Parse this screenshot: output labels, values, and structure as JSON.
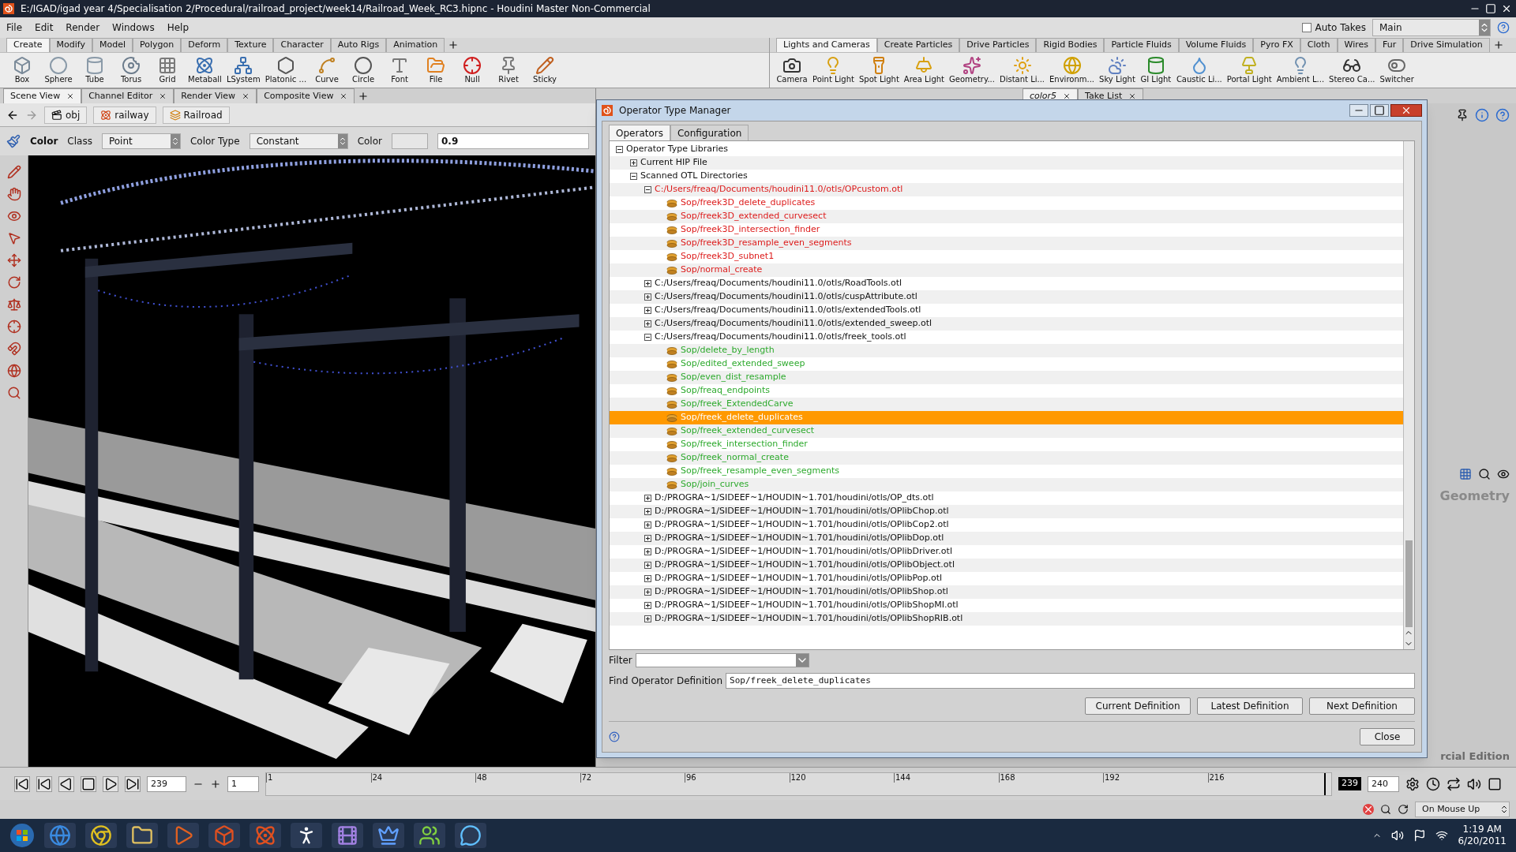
{
  "window": {
    "title": "E:/IGAD/igad year 4/Specialisation 2/Procedural/railroad_project/week14/Railroad_Week_RC3.hipnc - Houdini Master Non-Commercial"
  },
  "menu": [
    "File",
    "Edit",
    "Render",
    "Windows",
    "Help"
  ],
  "takes": {
    "auto_takes": {
      "label": "Auto Takes",
      "checked": false
    },
    "desktop": "Main"
  },
  "shelf_left": {
    "tabs": [
      {
        "label": "Create",
        "selected": true
      },
      {
        "label": "Modify",
        "selected": false
      },
      {
        "label": "Model",
        "selected": false
      },
      {
        "label": "Polygon",
        "selected": false
      },
      {
        "label": "Deform",
        "selected": false
      },
      {
        "label": "Texture",
        "selected": false
      },
      {
        "label": "Character",
        "selected": false
      },
      {
        "label": "Auto Rigs",
        "selected": false
      },
      {
        "label": "Animation",
        "selected": false
      }
    ],
    "tools": [
      "Box",
      "Sphere",
      "Tube",
      "Torus",
      "Grid",
      "Metaball",
      "LSystem",
      "Platonic ...",
      "Curve",
      "Circle",
      "Font",
      "File",
      "Null",
      "Rivet",
      "Sticky"
    ]
  },
  "shelf_right": {
    "tabs": [
      {
        "label": "Lights and Cameras",
        "selected": true
      },
      {
        "label": "Create Particles",
        "selected": false
      },
      {
        "label": "Drive Particles",
        "selected": false
      },
      {
        "label": "Rigid Bodies",
        "selected": false
      },
      {
        "label": "Particle Fluids",
        "selected": false
      },
      {
        "label": "Volume Fluids",
        "selected": false
      },
      {
        "label": "Pyro FX",
        "selected": false
      },
      {
        "label": "Cloth",
        "selected": false
      },
      {
        "label": "Wires",
        "selected": false
      },
      {
        "label": "Fur",
        "selected": false
      },
      {
        "label": "Drive Simulation",
        "selected": false
      }
    ],
    "tools": [
      "Camera",
      "Point Light",
      "Spot Light",
      "Area Light",
      "Geometry...",
      "Distant Li...",
      "Environm...",
      "Sky Light",
      "GI Light",
      "Caustic Li...",
      "Portal Light",
      "Ambient L...",
      "Stereo Ca...",
      "Switcher"
    ]
  },
  "pane_tabs": [
    {
      "label": "Scene View",
      "selected": true
    },
    {
      "label": "Channel Editor",
      "selected": false
    },
    {
      "label": "Render View",
      "selected": false
    },
    {
      "label": "Composite View",
      "selected": false
    }
  ],
  "path": [
    "obj",
    "railway",
    "Railroad"
  ],
  "op_toolbar": {
    "node": "Color",
    "class_label": "Class",
    "class_value": "Point",
    "color_type_label": "Color Type",
    "color_type_value": "Constant",
    "color_label": "Color",
    "value": "0.9"
  },
  "right_pane": {
    "tabs": [
      {
        "label": "color5",
        "selected": true
      },
      {
        "label": "Take List",
        "selected": false
      }
    ],
    "network_label": "Geometry",
    "edition": "rcial Edition"
  },
  "dialog": {
    "title": "Operator Type Manager",
    "tabs": [
      {
        "label": "Operators",
        "selected": true
      },
      {
        "label": "Configuration",
        "selected": false
      }
    ],
    "tree": [
      {
        "label": "Operator Type Libraries",
        "expanded": true,
        "children": [
          {
            "label": "Current HIP File",
            "expanded": false
          },
          {
            "label": "Scanned OTL Directories",
            "expanded": true,
            "children": [
              {
                "label": "C:/Users/freaq/Documents/houdini11.0/otls/OPcustom.otl",
                "expanded": true,
                "color": "#dd1c1c",
                "children": [
                  {
                    "label": "Sop/freek3D_delete_duplicates",
                    "selected": false,
                    "color": "#dd1c1c"
                  },
                  {
                    "label": "Sop/freek3D_extended_curvesect",
                    "selected": false,
                    "color": "#dd1c1c"
                  },
                  {
                    "label": "Sop/freek3D_intersection_finder",
                    "selected": false,
                    "color": "#dd1c1c"
                  },
                  {
                    "label": "Sop/freek3D_resample_even_segments",
                    "selected": false,
                    "color": "#dd1c1c"
                  },
                  {
                    "label": "Sop/freek3D_subnet1",
                    "selected": false,
                    "color": "#dd1c1c"
                  },
                  {
                    "label": "Sop/normal_create",
                    "selected": false,
                    "color": "#dd1c1c"
                  }
                ]
              },
              {
                "label": "C:/Users/freaq/Documents/houdini11.0/otls/RoadTools.otl",
                "expanded": false
              },
              {
                "label": "C:/Users/freaq/Documents/houdini11.0/otls/cuspAttribute.otl",
                "expanded": false
              },
              {
                "label": "C:/Users/freaq/Documents/houdini11.0/otls/extendedTools.otl",
                "expanded": false
              },
              {
                "label": "C:/Users/freaq/Documents/houdini11.0/otls/extended_sweep.otl",
                "expanded": false
              },
              {
                "label": "C:/Users/freaq/Documents/houdini11.0/otls/freek_tools.otl",
                "expanded": true,
                "children": [
                  {
                    "label": "Sop/delete_by_length",
                    "selected": false,
                    "color": "#2eaa2e"
                  },
                  {
                    "label": "Sop/edited_extended_sweep",
                    "selected": false,
                    "color": "#2eaa2e"
                  },
                  {
                    "label": "Sop/even_dist_resample",
                    "selected": false,
                    "color": "#2eaa2e"
                  },
                  {
                    "label": "Sop/freaq_endpoints",
                    "selected": false,
                    "color": "#2eaa2e"
                  },
                  {
                    "label": "Sop/freek_ExtendedCarve",
                    "selected": false,
                    "color": "#2eaa2e"
                  },
                  {
                    "label": "Sop/freek_delete_duplicates",
                    "selected": true
                  },
                  {
                    "label": "Sop/freek_extended_curvesect",
                    "selected": false,
                    "color": "#2eaa2e"
                  },
                  {
                    "label": "Sop/freek_intersection_finder",
                    "selected": false,
                    "color": "#2eaa2e"
                  },
                  {
                    "label": "Sop/freek_normal_create",
                    "selected": false,
                    "color": "#2eaa2e"
                  },
                  {
                    "label": "Sop/freek_resample_even_segments",
                    "selected": false,
                    "color": "#2eaa2e"
                  },
                  {
                    "label": "Sop/join_curves",
                    "selected": false,
                    "color": "#2eaa2e"
                  }
                ]
              },
              {
                "label": "D:/PROGRA~1/SIDEEF~1/HOUDIN~1.701/houdini/otls/OP_dts.otl",
                "expanded": false
              },
              {
                "label": "D:/PROGRA~1/SIDEEF~1/HOUDIN~1.701/houdini/otls/OPlibChop.otl",
                "expanded": false
              },
              {
                "label": "D:/PROGRA~1/SIDEEF~1/HOUDIN~1.701/houdini/otls/OPlibCop2.otl",
                "expanded": false
              },
              {
                "label": "D:/PROGRA~1/SIDEEF~1/HOUDIN~1.701/houdini/otls/OPlibDop.otl",
                "expanded": false
              },
              {
                "label": "D:/PROGRA~1/SIDEEF~1/HOUDIN~1.701/houdini/otls/OPlibDriver.otl",
                "expanded": false
              },
              {
                "label": "D:/PROGRA~1/SIDEEF~1/HOUDIN~1.701/houdini/otls/OPlibObject.otl",
                "expanded": false
              },
              {
                "label": "D:/PROGRA~1/SIDEEF~1/HOUDIN~1.701/houdini/otls/OPlibPop.otl",
                "expanded": false
              },
              {
                "label": "D:/PROGRA~1/SIDEEF~1/HOUDIN~1.701/houdini/otls/OPlibShop.otl",
                "expanded": false
              },
              {
                "label": "D:/PROGRA~1/SIDEEF~1/HOUDIN~1.701/houdini/otls/OPlibShopMI.otl",
                "expanded": false
              },
              {
                "label": "D:/PROGRA~1/SIDEEF~1/HOUDIN~1.701/houdini/otls/OPlibShopRIB.otl",
                "expanded": false
              }
            ]
          }
        ]
      }
    ],
    "filter_label": "Filter",
    "find": {
      "label": "Find Operator Definition",
      "value": "Sop/freek_delete_duplicates"
    },
    "buttons": [
      "Current Definition",
      "Latest Definition",
      "Next Definition"
    ],
    "close": "Close"
  },
  "timeline": {
    "frame": "239",
    "step": "1",
    "ticks": [
      "1",
      "24",
      "48",
      "72",
      "96",
      "120",
      "144",
      "168",
      "192",
      "216"
    ],
    "current": "239",
    "level": 0.995,
    "end": "240"
  },
  "status": {
    "update_mode": "On Mouse Up"
  },
  "taskbar": {
    "time": "1:19 AM",
    "date": "6/20/2011"
  }
}
